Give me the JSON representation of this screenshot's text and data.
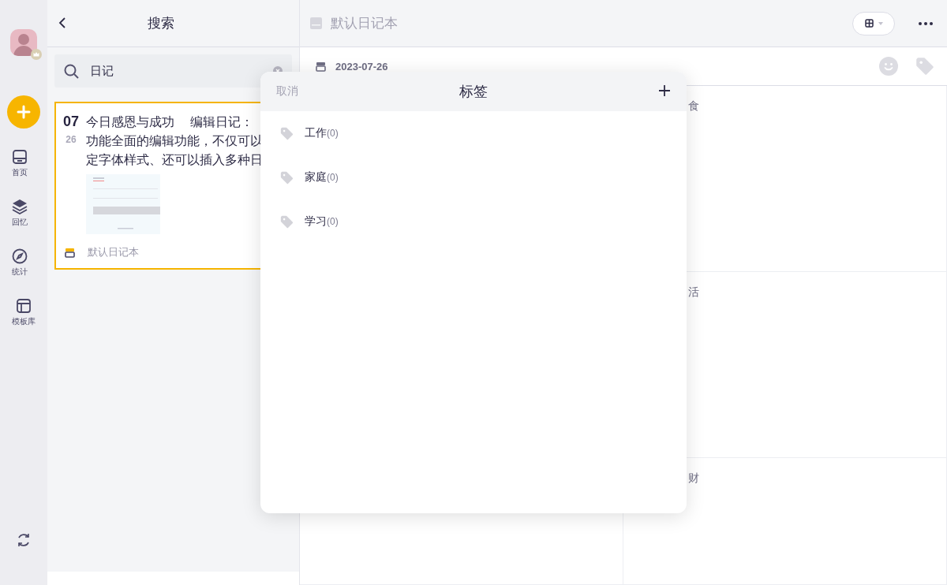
{
  "rail": {
    "items": [
      {
        "kind": "home",
        "label": "首页"
      },
      {
        "kind": "layers",
        "label": "回忆"
      },
      {
        "kind": "compass",
        "label": "统计"
      },
      {
        "kind": "template",
        "label": "模板库"
      }
    ]
  },
  "search_panel": {
    "title": "搜索",
    "search": {
      "value": "日记"
    },
    "results": [
      {
        "month": "07",
        "day": "26",
        "text": "今日感恩与成功　 编辑日记：功能全面的编辑功能，不仅可以定字体样式、还可以插入多种日",
        "notebook": "默认日记本",
        "selected": true
      }
    ]
  },
  "notebook_header": {
    "title": "默认日记本"
  },
  "entry": {
    "date": "2023-07-26",
    "sections": [
      {
        "label": "食"
      },
      {
        "label": "活"
      },
      {
        "label": "财"
      }
    ]
  },
  "tag_dialog": {
    "cancel": "取消",
    "title": "标签",
    "tags": [
      {
        "name": "工作",
        "count": "(0)"
      },
      {
        "name": "家庭",
        "count": "(0)"
      },
      {
        "name": "学习",
        "count": "(0)"
      }
    ]
  }
}
